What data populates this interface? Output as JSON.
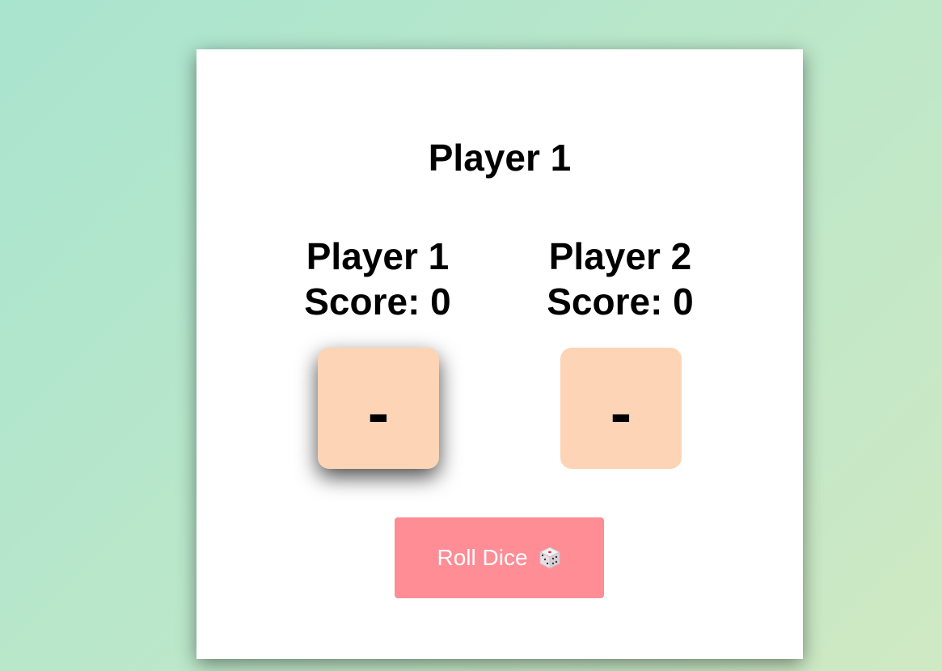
{
  "game": {
    "turn_title": "Player 1",
    "players": [
      {
        "name": "Player 1",
        "score_text": "Score: 0",
        "die_value": "-"
      },
      {
        "name": "Player 2",
        "score_text": "Score: 0",
        "die_value": "-"
      }
    ],
    "roll_button_label": "Roll Dice",
    "roll_button_icon": "dice-icon",
    "active_player_index": 0
  },
  "colors": {
    "background_start": "#a9e4cf",
    "background_end": "#cfe9c3",
    "card": "#ffffff",
    "die_face": "#fdd4b5",
    "button": "#fe8d96",
    "button_text": "#ffffff"
  }
}
